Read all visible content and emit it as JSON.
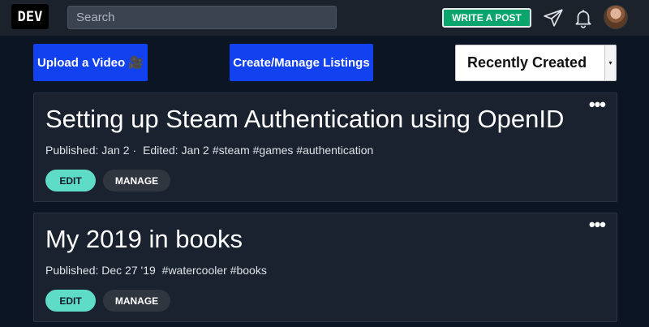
{
  "nav": {
    "logo": "DEV",
    "search_placeholder": "Search",
    "write_post": "WRITE A POST",
    "icons": [
      "paper-plane-icon",
      "bell-icon"
    ]
  },
  "actions": {
    "upload": "Upload a Video 🎥",
    "listings": "Create/Manage Listings",
    "sort_selected": "Recently Created"
  },
  "posts": [
    {
      "title": "Setting up Steam Authentication using OpenID",
      "published": "Published: Jan 2",
      "separator": "·",
      "edited": "Edited: Jan 2",
      "tags": "#steam #games #authentication",
      "edit": "EDIT",
      "manage": "MANAGE",
      "menu": "•••"
    },
    {
      "title": "My 2019 in books",
      "published": "Published: Dec 27 '19",
      "tags": "#watercooler #books",
      "edit": "EDIT",
      "manage": "MANAGE",
      "menu": "•••"
    }
  ],
  "colors": {
    "nav_bg": "#1b222c",
    "page_bg": "#0c1524",
    "card_bg": "#19222e",
    "accent_blue": "#1241f0",
    "write_green": "#0aa56c",
    "edit_teal": "#5fdcc8"
  }
}
